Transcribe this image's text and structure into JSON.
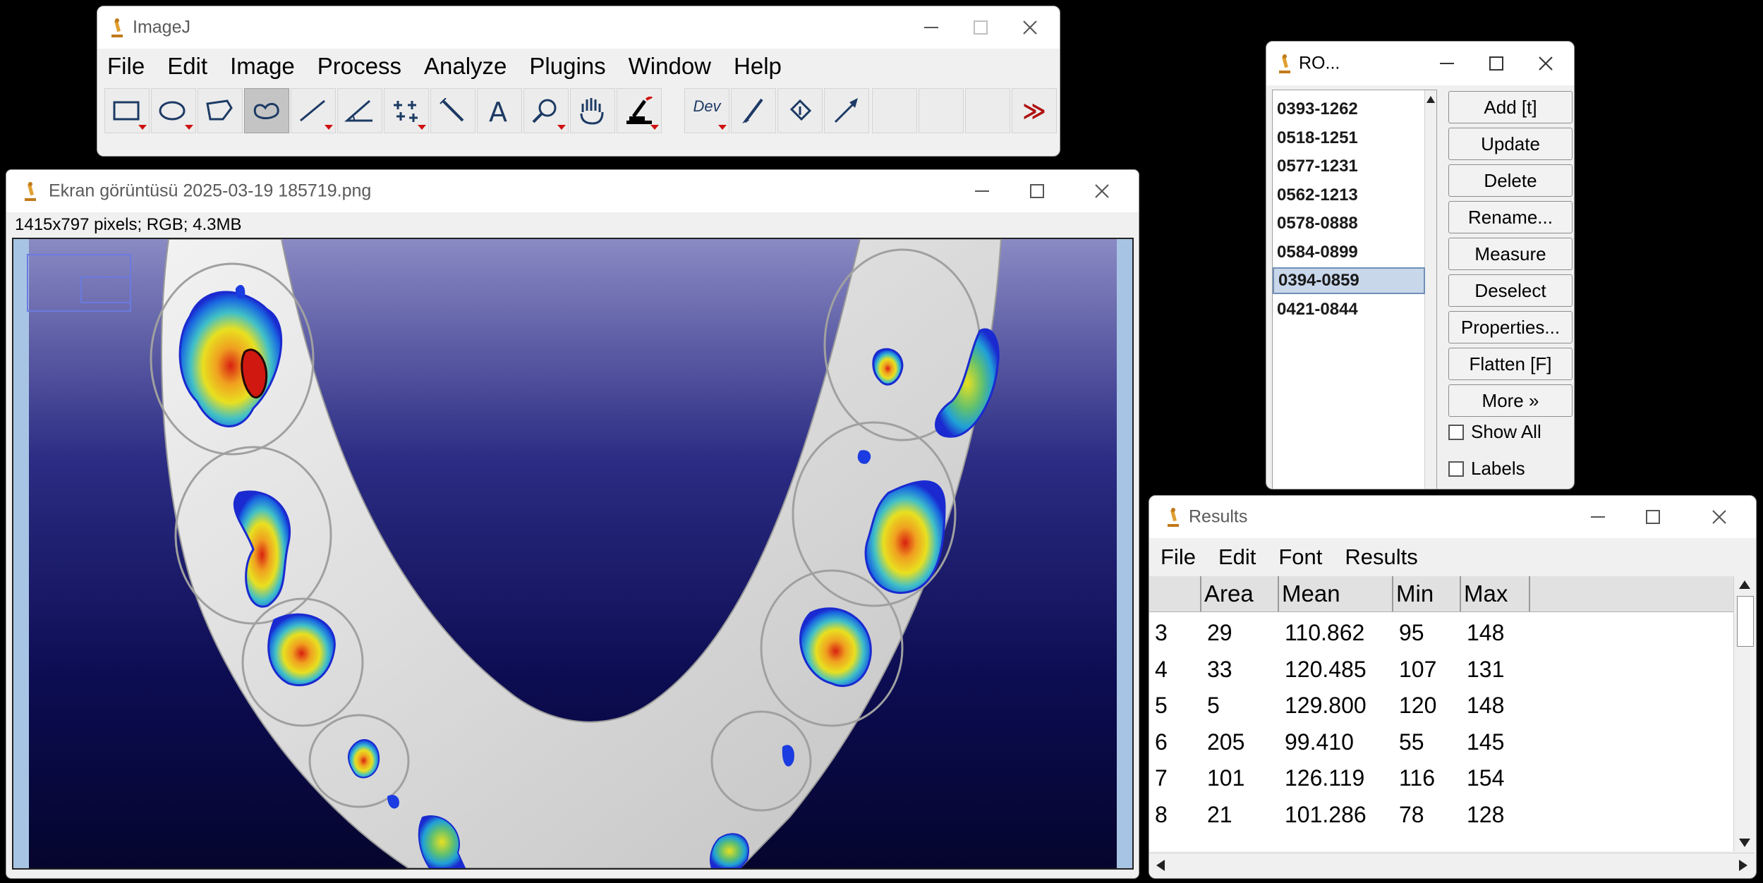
{
  "imagej": {
    "title": "ImageJ",
    "menu": [
      "File",
      "Edit",
      "Image",
      "Process",
      "Analyze",
      "Plugins",
      "Window",
      "Help"
    ],
    "tools": [
      "rectangle-tool-icon",
      "oval-tool-icon",
      "polygon-tool-icon",
      "freehand-tool-icon",
      "line-tool-icon",
      "angle-tool-icon",
      "multipoint-tool-icon",
      "wand-tool-icon",
      "text-tool-icon",
      "magnifier-tool-icon",
      "hand-tool-icon",
      "color-picker-icon",
      "developer-menu-icon",
      "brush-tool-icon",
      "flood-fill-icon",
      "arrow-tool-icon"
    ],
    "dev_label": "Dev",
    "more_label": "≫",
    "selected_tool": "freehand-tool-icon"
  },
  "image_window": {
    "title": "Ekran görüntüsü 2025-03-19 185719.png",
    "info": "1415x797 pixels; RGB; 4.3MB"
  },
  "roi_manager": {
    "title": "RO...",
    "items": [
      "0393-1262",
      "0518-1251",
      "0577-1231",
      "0562-1213",
      "0578-0888",
      "0584-0899",
      "0394-0859",
      "0421-0844"
    ],
    "selected_index": 6,
    "buttons": [
      "Add [t]",
      "Update",
      "Delete",
      "Rename...",
      "Measure",
      "Deselect",
      "Properties...",
      "Flatten [F]",
      "More »"
    ],
    "checkboxes": [
      "Show All",
      "Labels"
    ]
  },
  "results": {
    "title": "Results",
    "menu": [
      "File",
      "Edit",
      "Font",
      "Results"
    ],
    "columns": [
      "",
      "Area",
      "Mean",
      "Min",
      "Max"
    ],
    "rows": [
      [
        "3",
        "29",
        "110.862",
        "95",
        "148"
      ],
      [
        "4",
        "33",
        "120.485",
        "107",
        "131"
      ],
      [
        "5",
        "5",
        "129.800",
        "120",
        "148"
      ],
      [
        "6",
        "205",
        "99.410",
        "55",
        "145"
      ],
      [
        "7",
        "101",
        "126.119",
        "116",
        "154"
      ],
      [
        "8",
        "21",
        "101.286",
        "78",
        "128"
      ]
    ]
  },
  "colors": {
    "background": "#000000",
    "window": "#f0f0f0",
    "selection": "#c8d7ea",
    "image_bg_top": "#8a8ac4",
    "image_bg_bottom": "#0a0a40",
    "heat_blue": "#1a3ce0",
    "heat_yellow": "#e8e020",
    "heat_red": "#d82010"
  }
}
